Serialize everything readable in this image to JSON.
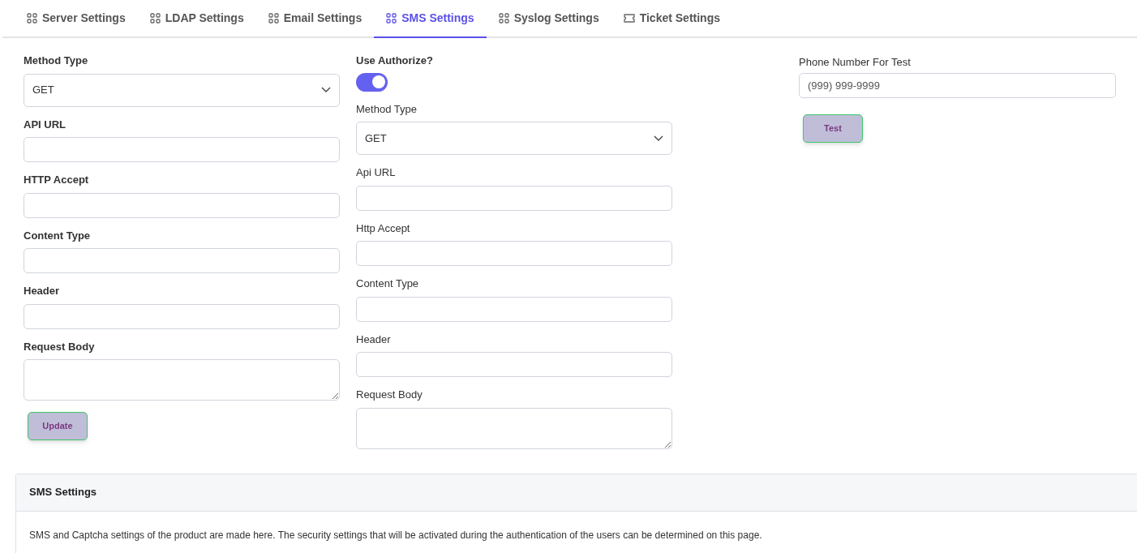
{
  "tabs": [
    {
      "label": "Server Settings",
      "kind": "grid",
      "selected": false
    },
    {
      "label": "LDAP Settings",
      "kind": "grid",
      "selected": false
    },
    {
      "label": "Email Settings",
      "kind": "grid",
      "selected": false
    },
    {
      "label": "SMS Settings",
      "kind": "grid",
      "selected": true
    },
    {
      "label": "Syslog Settings",
      "kind": "grid",
      "selected": false
    },
    {
      "label": "Ticket Settings",
      "kind": "ticket",
      "selected": false
    }
  ],
  "left_form": {
    "fields": [
      {
        "label": "Method Type",
        "kind": "select",
        "value": "GET"
      },
      {
        "label": "API URL",
        "kind": "text"
      },
      {
        "label": "HTTP Accept",
        "kind": "text"
      },
      {
        "label": "Content Type",
        "kind": "text"
      },
      {
        "label": "Header",
        "kind": "text"
      },
      {
        "label": "Request Body",
        "kind": "textarea"
      }
    ],
    "button": "Update"
  },
  "middle_form": {
    "toggle": {
      "label": "Use Authorize?",
      "on": true
    },
    "fields": [
      {
        "label": "Method Type",
        "kind": "select",
        "value": "GET"
      },
      {
        "label": "Api URL",
        "kind": "text"
      },
      {
        "label": "Http Accept",
        "kind": "text"
      },
      {
        "label": "Content Type",
        "kind": "text"
      },
      {
        "label": "Header",
        "kind": "text"
      },
      {
        "label": "Request Body",
        "kind": "textarea"
      }
    ]
  },
  "test_form": {
    "label": "Phone Number For Test",
    "placeholder": "(999) 999-9999",
    "button": "Test"
  },
  "info_card": {
    "title": "SMS Settings",
    "text": "SMS and Captcha settings of the product are made here. The security settings that will be activated during the authentication of the users can be determined on this page."
  }
}
